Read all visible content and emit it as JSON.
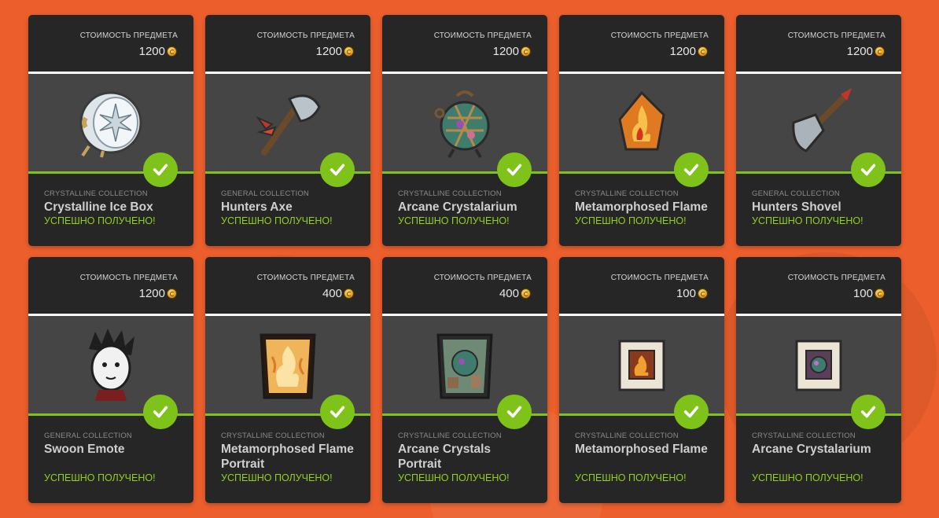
{
  "price_label": "СТОИМОСТЬ ПРЕДМЕТА",
  "status_text": "УСПЕШНО ПОЛУЧЕНО!",
  "accent_color": "#7fc21a",
  "background_color": "#ec5f2c",
  "items": [
    {
      "price": "1200",
      "collection": "CRYSTALLINE COLLECTION",
      "name": "Crystalline Ice Box",
      "status": "УСПЕШНО ПОЛУЧЕНО!",
      "icon": "ice-box-icon"
    },
    {
      "price": "1200",
      "collection": "GENERAL COLLECTION",
      "name": "Hunters Axe",
      "status": "УСПЕШНО ПОЛУЧЕНО!",
      "icon": "axe-icon"
    },
    {
      "price": "1200",
      "collection": "CRYSTALLINE COLLECTION",
      "name": "Arcane Crystalarium",
      "status": "УСПЕШНО ПОЛУЧЕНО!",
      "icon": "crystalarium-icon"
    },
    {
      "price": "1200",
      "collection": "CRYSTALLINE COLLECTION",
      "name": "Metamorphosed Flame",
      "status": "УСПЕШНО ПОЛУЧЕНО!",
      "icon": "flame-crystal-icon"
    },
    {
      "price": "1200",
      "collection": "GENERAL COLLECTION",
      "name": "Hunters Shovel",
      "status": "УСПЕШНО ПОЛУЧЕНО!",
      "icon": "shovel-icon"
    },
    {
      "price": "1200",
      "collection": "GENERAL COLLECTION",
      "name": "Swoon Emote",
      "status": "УСПЕШНО ПОЛУЧЕНО!",
      "icon": "character-face-icon"
    },
    {
      "price": "400",
      "collection": "CRYSTALLINE COLLECTION",
      "name": "Metamorphosed Flame Portrait",
      "status": "УСПЕШНО ПОЛУЧЕНО!",
      "icon": "flame-portrait-icon"
    },
    {
      "price": "400",
      "collection": "CRYSTALLINE COLLECTION",
      "name": "Arcane Crystals Portrait",
      "status": "УСПЕШНО ПОЛУЧЕНО!",
      "icon": "crystals-portrait-icon"
    },
    {
      "price": "100",
      "collection": "CRYSTALLINE COLLECTION",
      "name": "Metamorphosed Flame",
      "status": "УСПЕШНО ПОЛУЧЕНО!",
      "icon": "flame-frame-icon"
    },
    {
      "price": "100",
      "collection": "CRYSTALLINE COLLECTION",
      "name": "Arcane Crystalarium",
      "status": "УСПЕШНО ПОЛУЧЕНО!",
      "icon": "crystalarium-frame-icon"
    }
  ]
}
